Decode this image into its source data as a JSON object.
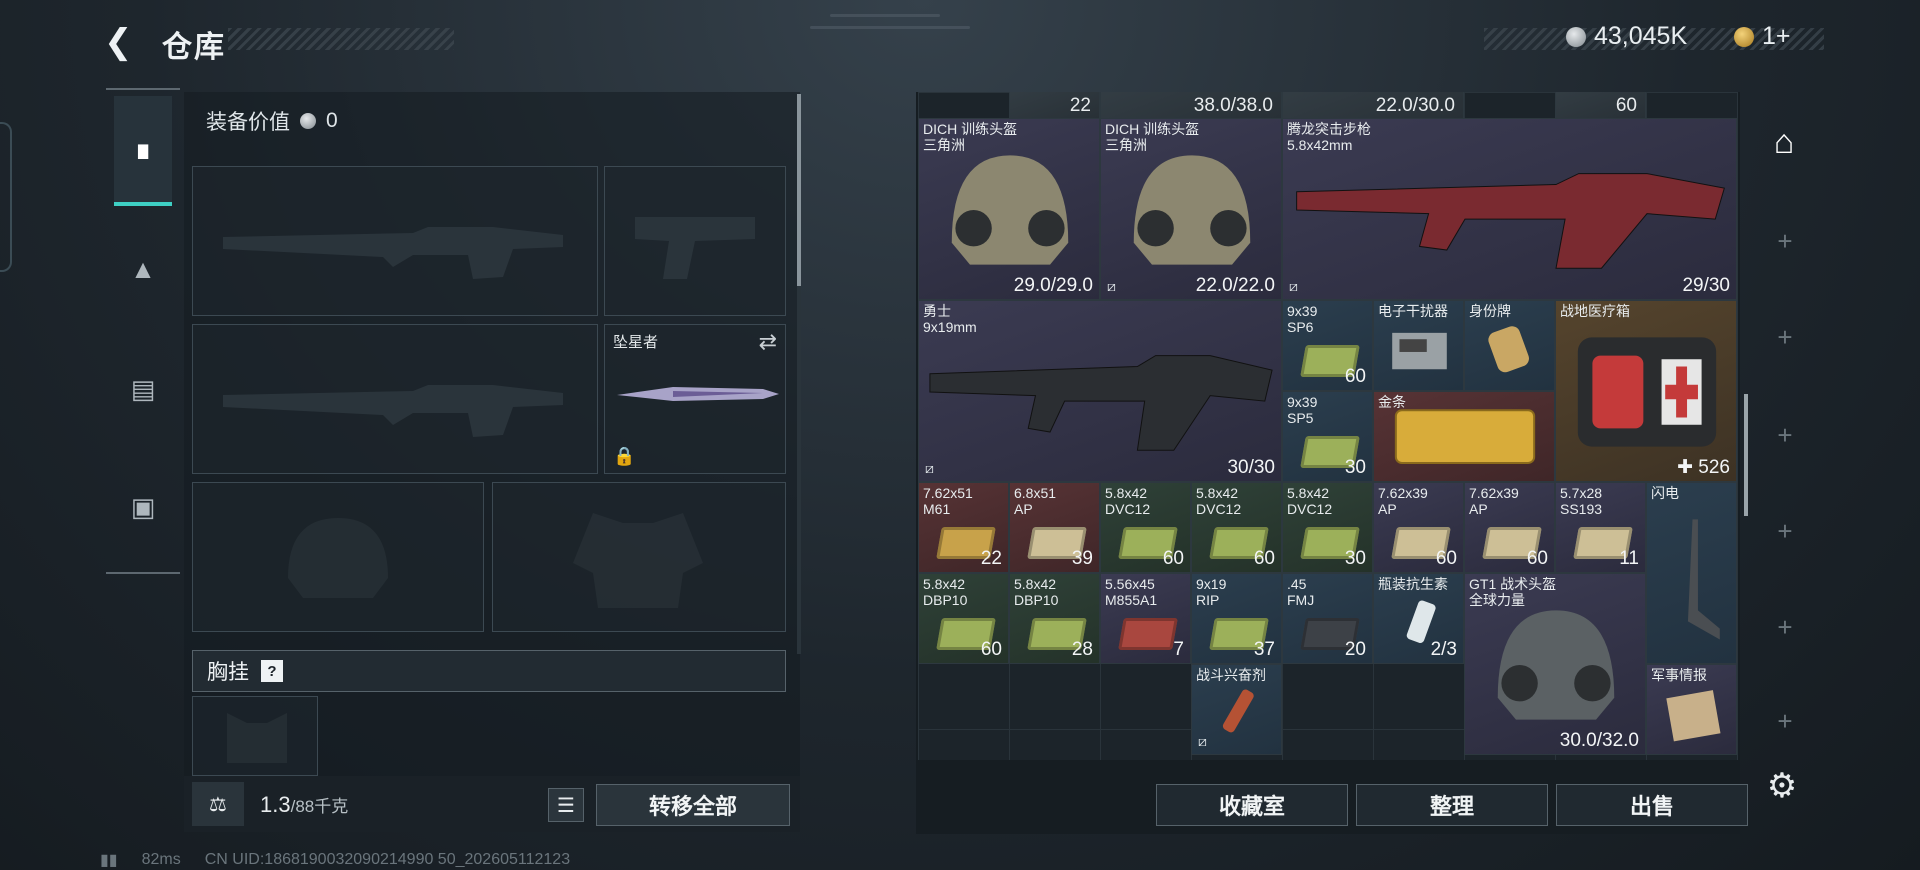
{
  "header": {
    "title": "仓库",
    "currency_main": "43,045K",
    "currency_gold": "1+",
    "tiny_label": "■■■ ■■"
  },
  "rail": {
    "items": [
      "weapon-icon",
      "backpack-icon",
      "armor-icon",
      "case-icon"
    ]
  },
  "equipment": {
    "value_label": "装备价值",
    "value": "0",
    "melee_name": "坠星者",
    "chest_label": "胸挂",
    "weight": "1.3",
    "weight_cap": "/88千克",
    "transfer_label": "转移全部"
  },
  "grid": {
    "top_row": [
      "22",
      "38.0/38.0",
      "22.0/30.0",
      "60"
    ],
    "items": [
      {
        "name": "DICH 训练头盔\n三角洲",
        "qty": "29.0/29.0",
        "nobind": false
      },
      {
        "name": "DICH 训练头盔\n三角洲",
        "qty": "22.0/22.0",
        "nobind": true
      },
      {
        "name": "腾龙突击步枪\n5.8x42mm",
        "qty": "29/30",
        "nobind": true
      },
      {
        "name": "勇士\n9x19mm",
        "qty": "30/30",
        "nobind": true
      },
      {
        "name": "9x39\nSP6",
        "qty": "60"
      },
      {
        "name": "电子干扰器",
        "qty": ""
      },
      {
        "name": "身份牌",
        "qty": ""
      },
      {
        "name": "战地医疗箱",
        "qty": "526",
        "plus": true
      },
      {
        "name": "9x39\nSP5",
        "qty": "30"
      },
      {
        "name": "金条",
        "qty": ""
      },
      {
        "name": "7.62x51\nM61",
        "qty": "22"
      },
      {
        "name": "6.8x51\nAP",
        "qty": "39"
      },
      {
        "name": "5.8x42\nDVC12",
        "qty": "60"
      },
      {
        "name": "5.8x42\nDVC12",
        "qty": "60"
      },
      {
        "name": "5.8x42\nDVC12",
        "qty": "30"
      },
      {
        "name": "7.62x39\nAP",
        "qty": "60"
      },
      {
        "name": "7.62x39\nAP",
        "qty": "60"
      },
      {
        "name": "5.7x28\nSS193",
        "qty": "11"
      },
      {
        "name": "闪电",
        "qty": ""
      },
      {
        "name": "5.8x42\nDBP10",
        "qty": "60"
      },
      {
        "name": "5.8x42\nDBP10",
        "qty": "28"
      },
      {
        "name": "5.56x45\nM855A1",
        "qty": "7"
      },
      {
        "name": "9x19\nRIP",
        "qty": "37"
      },
      {
        "name": ".45\nFMJ",
        "qty": "20"
      },
      {
        "name": "瓶装抗生素",
        "qty": "2/3"
      },
      {
        "name": "GT1 战术头盔\n全球力量",
        "qty": "30.0/32.0"
      },
      {
        "name": "战斗兴奋剂",
        "qty": "",
        "nobind": true
      },
      {
        "name": "军事情报",
        "qty": ""
      }
    ]
  },
  "buttons": {
    "collection": "收藏室",
    "sort": "整理",
    "sell": "出售"
  },
  "status": {
    "ping": "82ms",
    "uid": "CN UID:1868190032090214990 50_202605112123"
  }
}
